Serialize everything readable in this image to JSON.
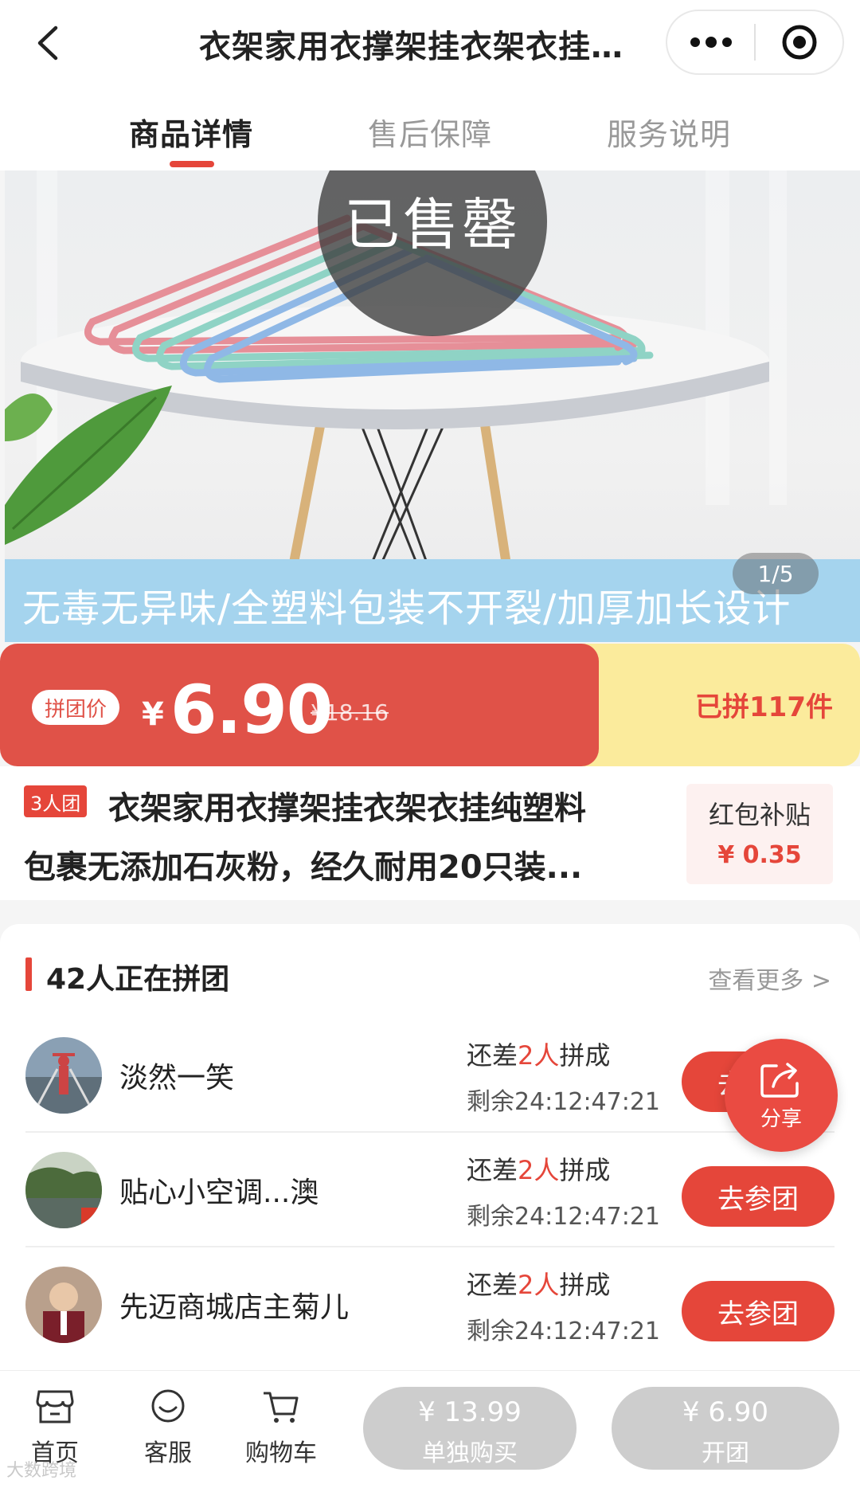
{
  "header": {
    "title": "衣架家用衣撑架挂衣架衣挂纯塑料包裹无添加石灰粉",
    "icons": [
      "chevron-left",
      "more-dots",
      "target-circle"
    ]
  },
  "tabs": [
    {
      "label": "商品详情"
    },
    {
      "label": "售后保障"
    },
    {
      "label": "服务说明"
    }
  ],
  "banner": {
    "overlay": "已售罄",
    "caption": "无毒无异味/全塑料包装不开裂/加厚加长设计",
    "page": "1/5"
  },
  "price": {
    "tag": "拼团价",
    "currency": "¥",
    "value": "6.90",
    "original": "¥18.16",
    "sold": "已拼117件"
  },
  "product": {
    "team_badge": "3人团",
    "title_line1": "衣架家用衣撑架挂衣架衣挂纯塑料",
    "title_line2": "包裹无添加石灰粉，经久耐用20只装...",
    "subsidy_label": "红包补贴",
    "subsidy_amount": "¥ 0.35"
  },
  "groups": {
    "title": "42人正在拼团",
    "more": "查看更多 >",
    "rows": [
      {
        "name": "淡然一笑",
        "need_prefix": "还差",
        "need_count": "2人",
        "need_suffix": "拼成",
        "remaining": "剩余24:12:47:21",
        "button": "去参团"
      },
      {
        "name": "贴心小空调...澳",
        "need_prefix": "还差",
        "need_count": "2人",
        "need_suffix": "拼成",
        "remaining": "剩余24:12:47:21",
        "button": "去参团"
      },
      {
        "name": "先迈商城店主菊儿",
        "need_prefix": "还差",
        "need_count": "2人",
        "need_suffix": "拼成",
        "remaining": "剩余24:12:47:21",
        "button": "去参团"
      }
    ]
  },
  "share": {
    "label": "分享"
  },
  "bottom": {
    "nav": [
      {
        "label": "首页",
        "icon": "store-icon"
      },
      {
        "label": "客服",
        "icon": "chat-icon"
      },
      {
        "label": "购物车",
        "icon": "cart-icon"
      }
    ],
    "buy_single": {
      "price": "¥ 13.99",
      "label": "单独购买"
    },
    "buy_group": {
      "price": "¥ 6.90",
      "label": "开团"
    },
    "watermark": "大数跨境"
  },
  "colors": {
    "accent": "#e5463a",
    "price_bg": "#e05248",
    "sold_bg": "#fbeb9c",
    "disabled": "#cdcdcd"
  }
}
